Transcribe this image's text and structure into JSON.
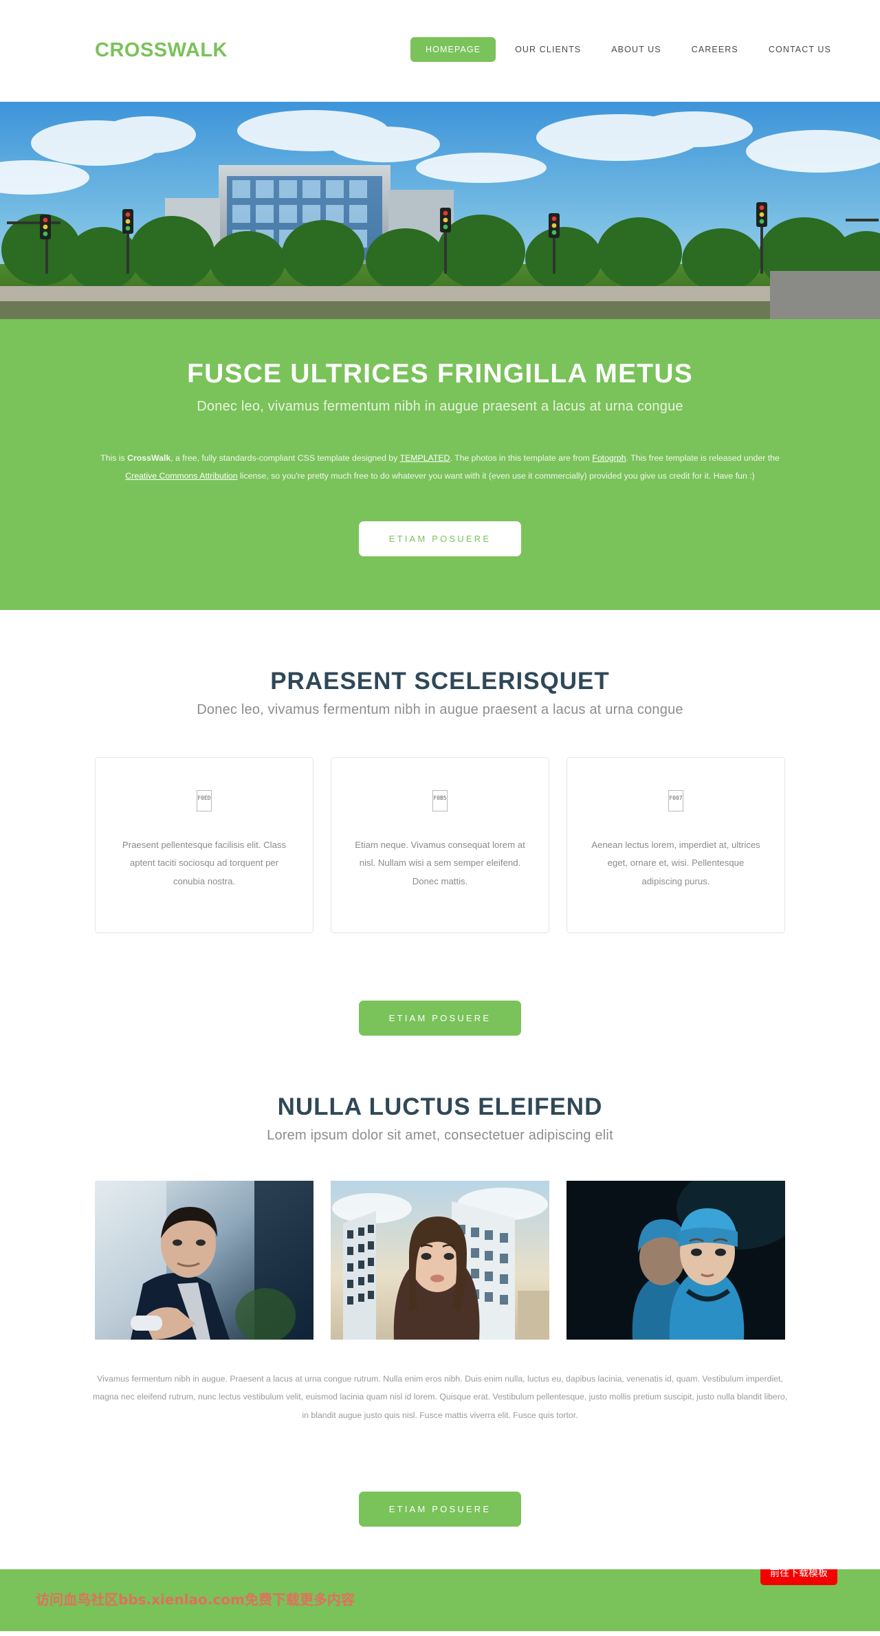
{
  "header": {
    "logo": "CROSSWALK",
    "nav": [
      {
        "label": "HOMEPAGE",
        "active": true
      },
      {
        "label": "OUR CLIENTS",
        "active": false
      },
      {
        "label": "ABOUT US",
        "active": false
      },
      {
        "label": "CAREERS",
        "active": false
      },
      {
        "label": "CONTACT US",
        "active": false
      }
    ]
  },
  "hero": {
    "title": "FUSCE ULTRICES FRINGILLA METUS",
    "subtitle": "Donec leo, vivamus fermentum nibh in augue praesent a lacus at urna congue",
    "copy_part1": "This is ",
    "copy_brand": "CrossWalk",
    "copy_part2": ", a free, fully standards-compliant CSS template designed by ",
    "link_templated": "TEMPLATED",
    "copy_part3": ". The photos in this template are from ",
    "link_fotogrph": "Fotogrph",
    "copy_part4": ". This free template is released under the ",
    "link_cc": "Creative Commons Attribution",
    "copy_part5": " license, so you're pretty much free to do whatever you want with it (even use it commercially) provided you give us credit for it. Have fun :)",
    "button": "ETIAM POSUERE"
  },
  "section_features": {
    "title": "PRAESENT SCELERISQUET",
    "subtitle": "Donec leo, vivamus fermentum nibh in augue praesent a lacus at urna congue",
    "boxes": [
      {
        "icon": "tofu-glyph-f0ed-icon",
        "icon_code": "F0ED",
        "text": "Praesent pellentesque facilisis elit. Class aptent taciti sociosqu ad torquent per conubia nostra."
      },
      {
        "icon": "tofu-glyph-f0b5-icon",
        "icon_code": "F0B5",
        "text": "Etiam neque. Vivamus consequat lorem at nisl. Nullam wisi a sem semper eleifend. Donec mattis."
      },
      {
        "icon": "tofu-glyph-f007-icon",
        "icon_code": "F007",
        "text": "Aenean lectus lorem, imperdiet at, ultrices eget, ornare et, wisi. Pellentesque adipiscing purus."
      }
    ],
    "button": "ETIAM POSUERE"
  },
  "section_gallery": {
    "title": "NULLA LUCTUS ELEIFEND",
    "subtitle": "Lorem ipsum dolor sit amet, consectetuer adipiscing elit",
    "images": [
      {
        "alt": "businessman-pointing-photo"
      },
      {
        "alt": "woman-in-city-photo"
      },
      {
        "alt": "surgeons-photo"
      }
    ],
    "copy": "Vivamus fermentum nibh in augue. Praesent a lacus at urna congue rutrum. Nulla enim eros nibh. Duis enim nulla, luctus eu, dapibus lacinia, venenatis id, quam. Vestibulum imperdiet, magna nec eleifend rutrum, nunc lectus vestibulum velit, euismod lacinia quam nisl id lorem. Quisque erat. Vestibulum pellentesque, justo mollis pretium suscipit, justo nulla blandit libero, in blandit augue justo quis nisl. Fusce mattis viverra elit. Fusce quis tortor.",
    "button": "ETIAM POSUERE"
  },
  "footer": {
    "watermark": "访问血鸟社区bbs.xienlao.com免费下载更多内容",
    "download_button": "前往下载模板"
  },
  "colors": {
    "brand_green": "#7ac25a",
    "heading_dark": "#2f4858",
    "watermark_red": "#e0705e",
    "download_red": "#f50000"
  }
}
